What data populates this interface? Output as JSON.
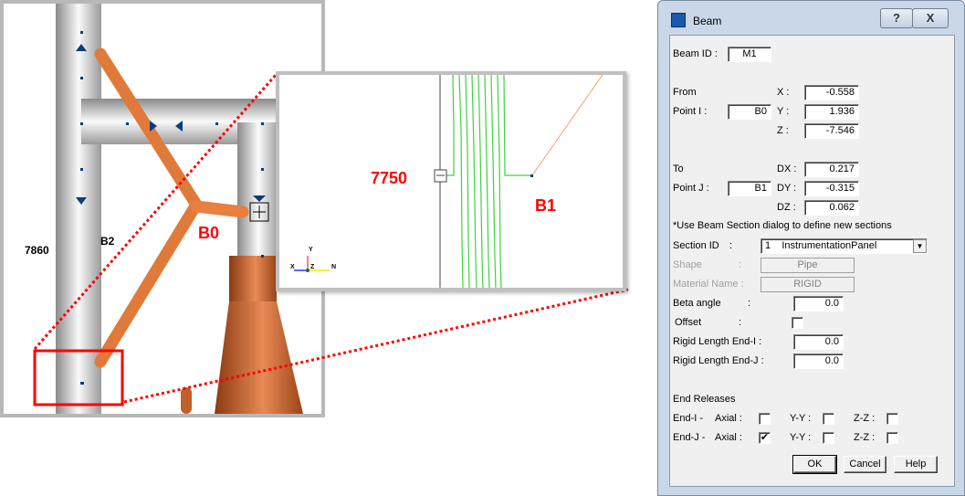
{
  "viewport": {
    "labels": {
      "node_b0": "B0",
      "node_b2": "B2",
      "elevation": "7860"
    }
  },
  "inset": {
    "labels": {
      "elevation": "7750",
      "node_b1": "B1"
    },
    "axis_triad": {
      "y": "Y",
      "x": "X",
      "z": "Z",
      "n": "N"
    }
  },
  "dialog": {
    "title": "Beam",
    "help_button": "?",
    "close_button": "X",
    "beam_id_label": "Beam ID :",
    "beam_id": "M1",
    "from_label": "From",
    "point_i_label": "Point I :",
    "point_i": "B0",
    "x_label": "X :",
    "x": "-0.558",
    "y_label": "Y :",
    "y": "1.936",
    "z_label": "Z :",
    "z": "-7.546",
    "to_label": "To",
    "point_j_label": "Point J :",
    "point_j": "B1",
    "dx_label": "DX :",
    "dx": "0.217",
    "dy_label": "DY :",
    "dy": "-0.315",
    "dz_label": "DZ :",
    "dz": "0.062",
    "note": "*Use Beam Section dialog to define new sections",
    "section_id_label": "Section ID",
    "colon": ":",
    "section_id_num": "1",
    "section_id_name": "InstrumentationPanel",
    "shape_label": "Shape",
    "shape": "Pipe",
    "material_label": "Material Name :",
    "material": "RIGID",
    "beta_label": "Beta angle",
    "beta": "0.0",
    "offset_label": "Offset",
    "offset_checked": false,
    "rigid_i_label": "Rigid Length End-I  :",
    "rigid_i": "0.0",
    "rigid_j_label": "Rigid Length End-J  :",
    "rigid_j": "0.0",
    "end_releases_label": "End Releases",
    "end_i_label": "End-I -",
    "end_j_label": "End-J -",
    "axial_label": "Axial :",
    "yy_label": "Y-Y :",
    "zz_label": "Z-Z :",
    "end_i": {
      "axial": false,
      "yy": false,
      "zz": false
    },
    "end_j": {
      "axial": true,
      "yy": false,
      "zz": false
    },
    "check_mark": "✔",
    "ok": "OK",
    "cancel": "Cancel",
    "help": "Help"
  }
}
